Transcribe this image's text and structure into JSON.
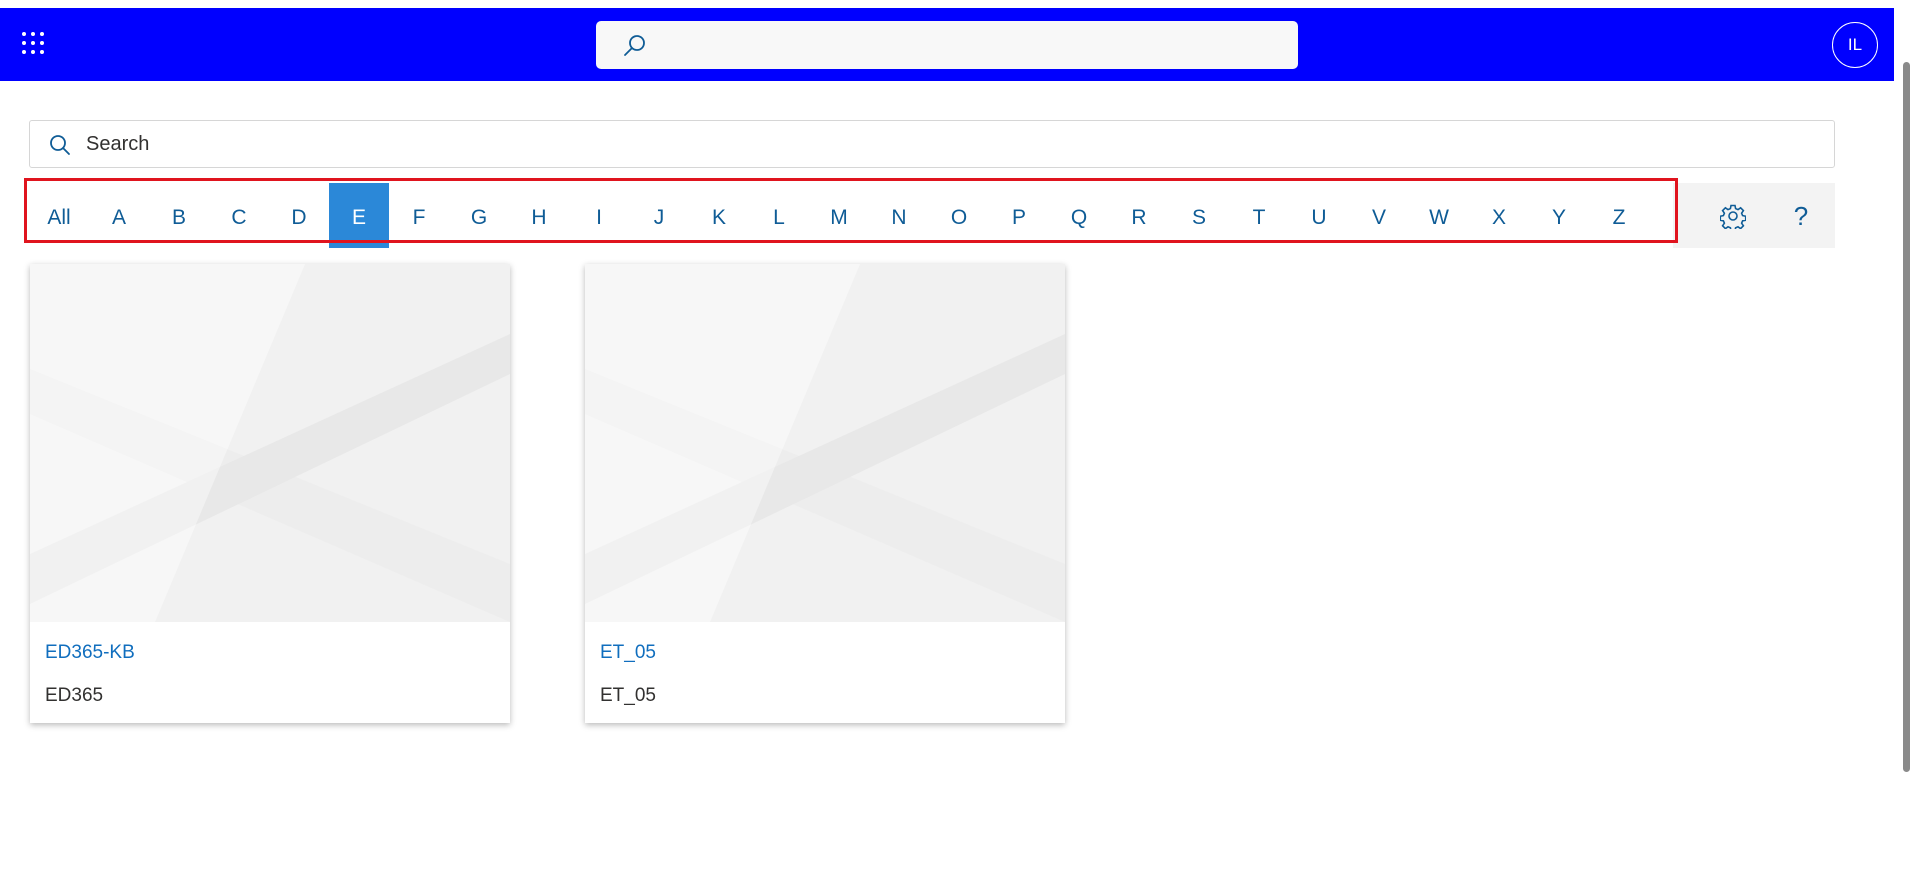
{
  "header": {
    "app_launcher_icon": "waffle-icon",
    "search_icon": "search-icon",
    "search_placeholder": "",
    "user_initials": "IL",
    "bar_color": "#0000ff"
  },
  "search": {
    "placeholder": "Search",
    "icon": "search-icon"
  },
  "alphabet_filter": {
    "letters": [
      "All",
      "A",
      "B",
      "C",
      "D",
      "E",
      "F",
      "G",
      "H",
      "I",
      "J",
      "K",
      "L",
      "M",
      "N",
      "O",
      "P",
      "Q",
      "R",
      "S",
      "T",
      "U",
      "V",
      "W",
      "X",
      "Y",
      "Z"
    ],
    "selected": "E",
    "selected_color": "#2b88d8",
    "settings_icon": "gear-icon",
    "help_label": "?"
  },
  "cards": [
    {
      "title": "ED365-KB",
      "subtitle": "ED365"
    },
    {
      "title": "ET_05",
      "subtitle": "ET_05"
    }
  ],
  "colors": {
    "link": "#106ebe",
    "highlight_border": "#e0141e"
  }
}
